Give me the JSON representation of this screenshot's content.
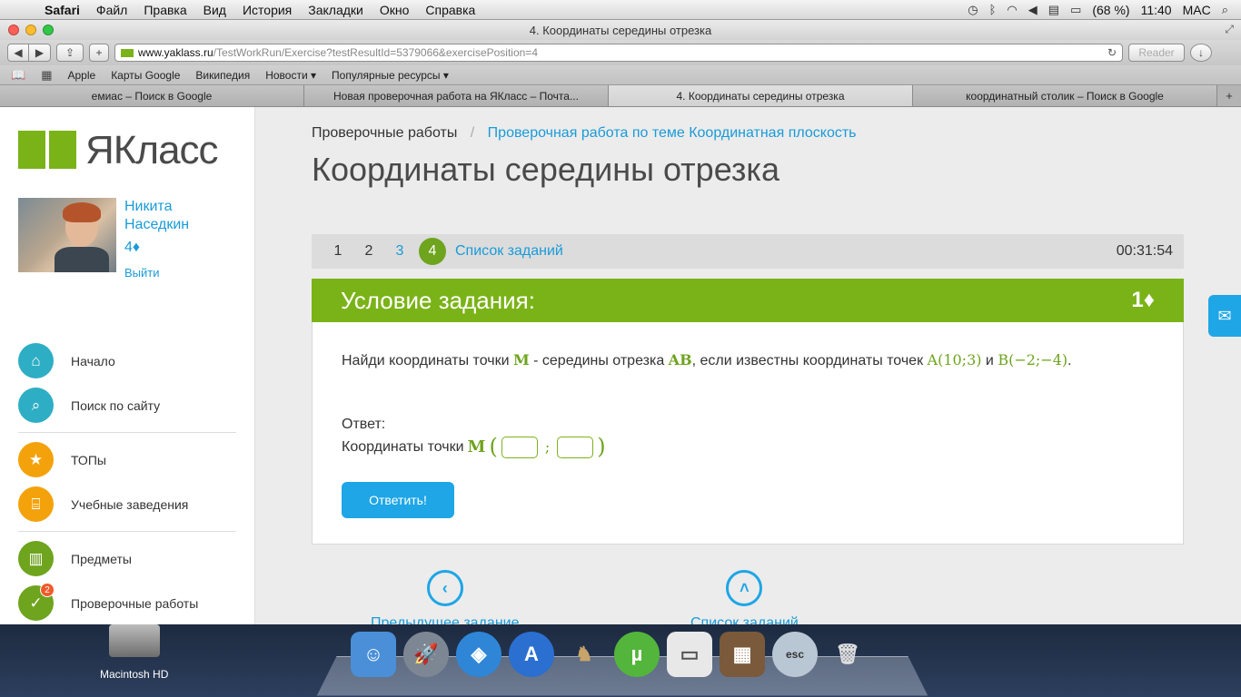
{
  "menubar": {
    "app_name": "Safari",
    "items": [
      "Файл",
      "Правка",
      "Вид",
      "История",
      "Закладки",
      "Окно",
      "Справка"
    ],
    "battery": "(68 %)",
    "time": "11:40",
    "user": "MAC"
  },
  "browser": {
    "window_title": "4. Координаты середины отрезка",
    "url_host": "www.yaklass.ru",
    "url_path": "/TestWorkRun/Exercise?testResultId=5379066&exercisePosition=4",
    "reader_label": "Reader",
    "bookmarks": [
      "Apple",
      "Карты Google",
      "Википедия",
      "Новости ▾",
      "Популярные ресурсы ▾"
    ],
    "tabs": [
      {
        "label": "емиас – Поиск в Google"
      },
      {
        "label": "Новая проверочная работа на ЯКласс – Почта..."
      },
      {
        "label": "4. Координаты середины отрезка"
      },
      {
        "label": "координатный столик – Поиск в Google"
      }
    ]
  },
  "sidebar": {
    "logo_text": "ЯКласс",
    "user_first": "Никита",
    "user_last": "Наседкин",
    "user_points": "4♦",
    "logout": "Выйти",
    "menu": [
      {
        "label": "Начало",
        "icon": "home-icon"
      },
      {
        "label": "Поиск по сайту",
        "icon": "search-icon"
      },
      {
        "label": "ТОПы",
        "icon": "star-icon"
      },
      {
        "label": "Учебные заведения",
        "icon": "institution-icon"
      },
      {
        "label": "Предметы",
        "icon": "book-icon"
      },
      {
        "label": "Проверочные работы",
        "icon": "check-icon",
        "badge": "2"
      }
    ]
  },
  "main": {
    "breadcrumb_root": "Проверочные работы",
    "breadcrumb_sep": "/",
    "breadcrumb_link": "Проверочная работа по теме Координатная плоскость",
    "title": "Координаты середины отрезка",
    "task_numbers": [
      "1",
      "2",
      "3",
      "4"
    ],
    "task_list_label": "Список заданий",
    "timer": "00:31:54",
    "condition_title": "Условие задания:",
    "condition_points": "1♦",
    "problem": {
      "t1": "Найди координаты точки ",
      "m": "M",
      "t2": " - середины отрезка ",
      "ab": "AB",
      "t3": ", если известны координаты точек ",
      "a": "A(10;3)",
      "t4": " и ",
      "b": "B(−2;−4)",
      "t5": "."
    },
    "answer_label": "Ответ:",
    "coords_label": "Координаты точки ",
    "coords_point": "M",
    "submit_label": "Ответить!",
    "prev_label": "Предыдущее задание",
    "list_label": "Список заданий"
  },
  "desktop": {
    "hd_label": "Macintosh HD"
  }
}
